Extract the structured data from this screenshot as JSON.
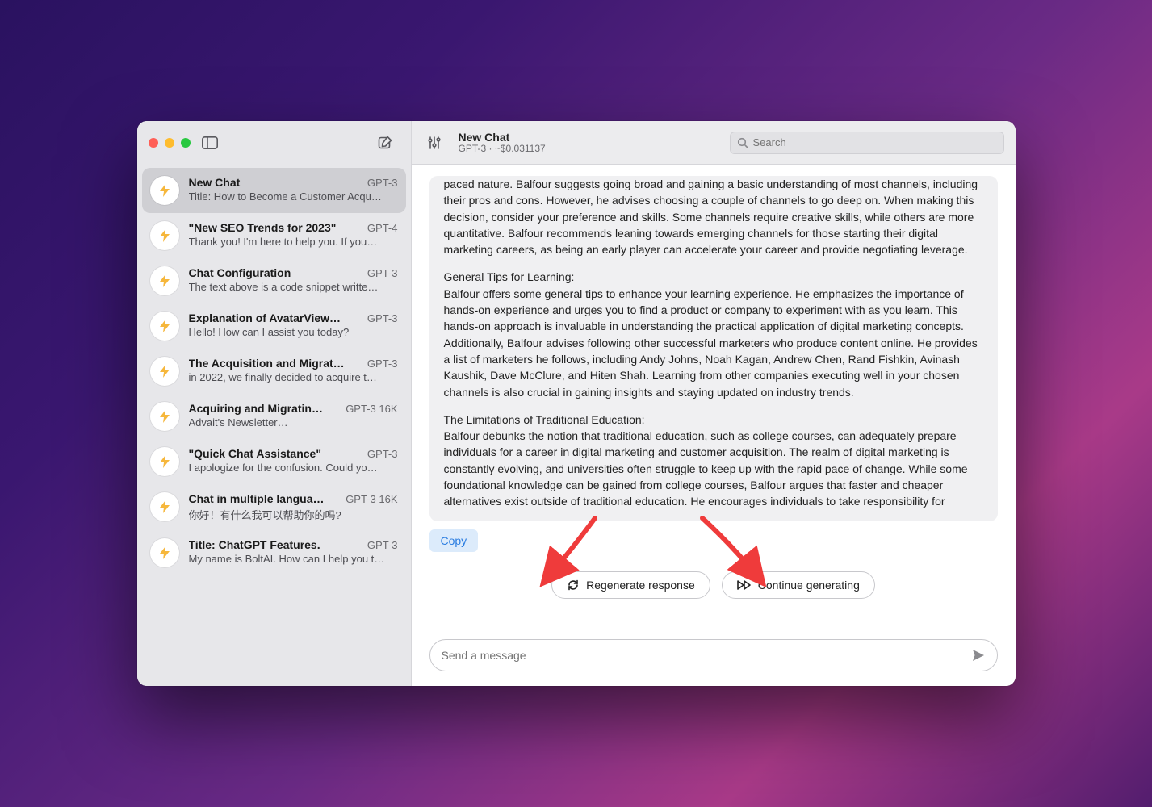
{
  "header": {
    "title": "New Chat",
    "subtitle": "GPT-3 · ~$0.031137",
    "search_placeholder": "Search"
  },
  "sidebar": {
    "items": [
      {
        "title": "New Chat",
        "model": "GPT-3",
        "preview": "Title: How to Become a Customer Acqu…",
        "selected": true
      },
      {
        "title": "\"New SEO Trends for 2023\"",
        "model": "GPT-4",
        "preview": "Thank you! I'm here to help you. If you…"
      },
      {
        "title": "Chat Configuration",
        "model": "GPT-3",
        "preview": "The text above is a code snippet writte…"
      },
      {
        "title": "Explanation of AvatarView…",
        "model": "GPT-3",
        "preview": "Hello! How can I assist you today?"
      },
      {
        "title": "The Acquisition and Migrat…",
        "model": "GPT-3",
        "preview": "in 2022, we finally decided to acquire t…"
      },
      {
        "title": "Acquiring and Migratin…",
        "model": "GPT-3 16K",
        "preview": "Advait's Newsletter…"
      },
      {
        "title": "\"Quick Chat Assistance\"",
        "model": "GPT-3",
        "preview": "I apologize for the confusion. Could yo…"
      },
      {
        "title": "Chat in multiple langua…",
        "model": "GPT-3 16K",
        "preview": "你好！有什么我可以帮助你的吗?"
      },
      {
        "title": "Title: ChatGPT Features.",
        "model": "GPT-3",
        "preview": "My name is BoltAI. How can I help you t…"
      }
    ]
  },
  "message": {
    "p1": "paced nature. Balfour suggests going broad and gaining a basic understanding of most channels, including their pros and cons. However, he advises choosing a couple of channels to go deep on. When making this decision, consider your preference and skills. Some channels require creative skills, while others are more quantitative. Balfour recommends leaning towards emerging channels for those starting their digital marketing careers, as being an early player can accelerate your career and provide negotiating leverage.",
    "p2": "General Tips for Learning:\nBalfour offers some general tips to enhance your learning experience. He emphasizes the importance of hands-on experience and urges you to find a product or company to experiment with as you learn. This hands-on approach is invaluable in understanding the practical application of digital marketing concepts. Additionally, Balfour advises following other successful marketers who produce content online. He provides a list of marketers he follows, including Andy Johns, Noah Kagan, Andrew Chen, Rand Fishkin, Avinash Kaushik, Dave McClure, and Hiten Shah. Learning from other companies executing well in your chosen channels is also crucial in gaining insights and staying updated on industry trends.",
    "p3": "The Limitations of Traditional Education:\nBalfour debunks the notion that traditional education, such as college courses, can adequately prepare individuals for a career in digital marketing and customer acquisition. The realm of digital marketing is constantly evolving, and universities often struggle to keep up with the rapid pace of change. While some foundational knowledge can be gained from college courses, Balfour argues that faster and cheaper alternatives exist outside of traditional education. He encourages individuals to take responsibility for"
  },
  "actions": {
    "copy": "Copy",
    "regenerate": "Regenerate response",
    "continue": "Continue generating"
  },
  "composer": {
    "placeholder": "Send a message"
  }
}
